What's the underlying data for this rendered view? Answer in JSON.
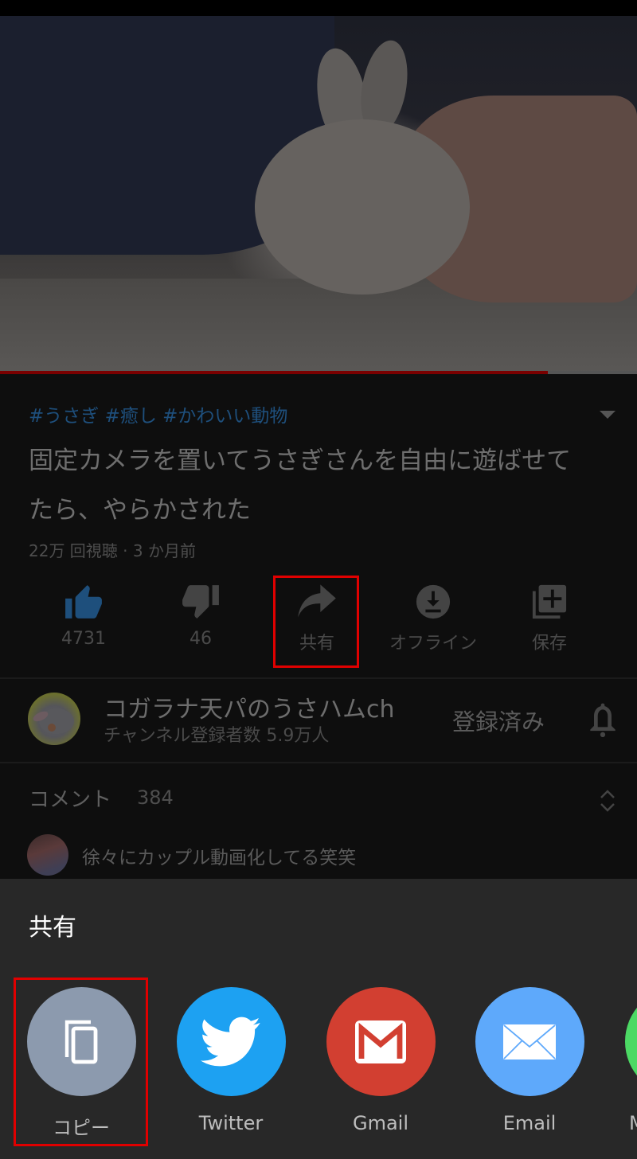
{
  "video": {
    "progress_percent": 86,
    "hashtags": "#うさぎ #癒し #かわいい動物",
    "title": "固定カメラを置いてうさぎさんを自由に遊ばせてたら、やらかされた",
    "meta": "22万 回視聴 · 3 か月前"
  },
  "actions": [
    {
      "icon": "thumbs-up-icon",
      "label": "4731"
    },
    {
      "icon": "thumbs-down-icon",
      "label": "46"
    },
    {
      "icon": "share-icon",
      "label": "共有"
    },
    {
      "icon": "download-icon",
      "label": "オフライン"
    },
    {
      "icon": "add-to-playlist-icon",
      "label": "保存"
    }
  ],
  "channel": {
    "name": "コガラナ天パのうさハムch",
    "subscribers": "チャンネル登録者数 5.9万人",
    "subscribed_label": "登録済み"
  },
  "comments": {
    "label": "コメント",
    "count": "384",
    "top_comment": "徐々にカップル動画化してる笑笑"
  },
  "share_sheet": {
    "title": "共有",
    "targets": [
      {
        "label": "コピー",
        "icon": "copy-icon",
        "color": "#8c9aae"
      },
      {
        "label": "Twitter",
        "icon": "twitter-icon",
        "color": "#1da1f2"
      },
      {
        "label": "Gmail",
        "icon": "gmail-icon",
        "color": "#d23f31"
      },
      {
        "label": "Email",
        "icon": "email-icon",
        "color": "#5ea9fb"
      },
      {
        "label": "M",
        "icon": "messages-icon",
        "color": "#4cd964"
      }
    ]
  },
  "colors": {
    "highlight": "#e00000",
    "like_active": "#1e4f7c",
    "progress": "#7a0000"
  }
}
